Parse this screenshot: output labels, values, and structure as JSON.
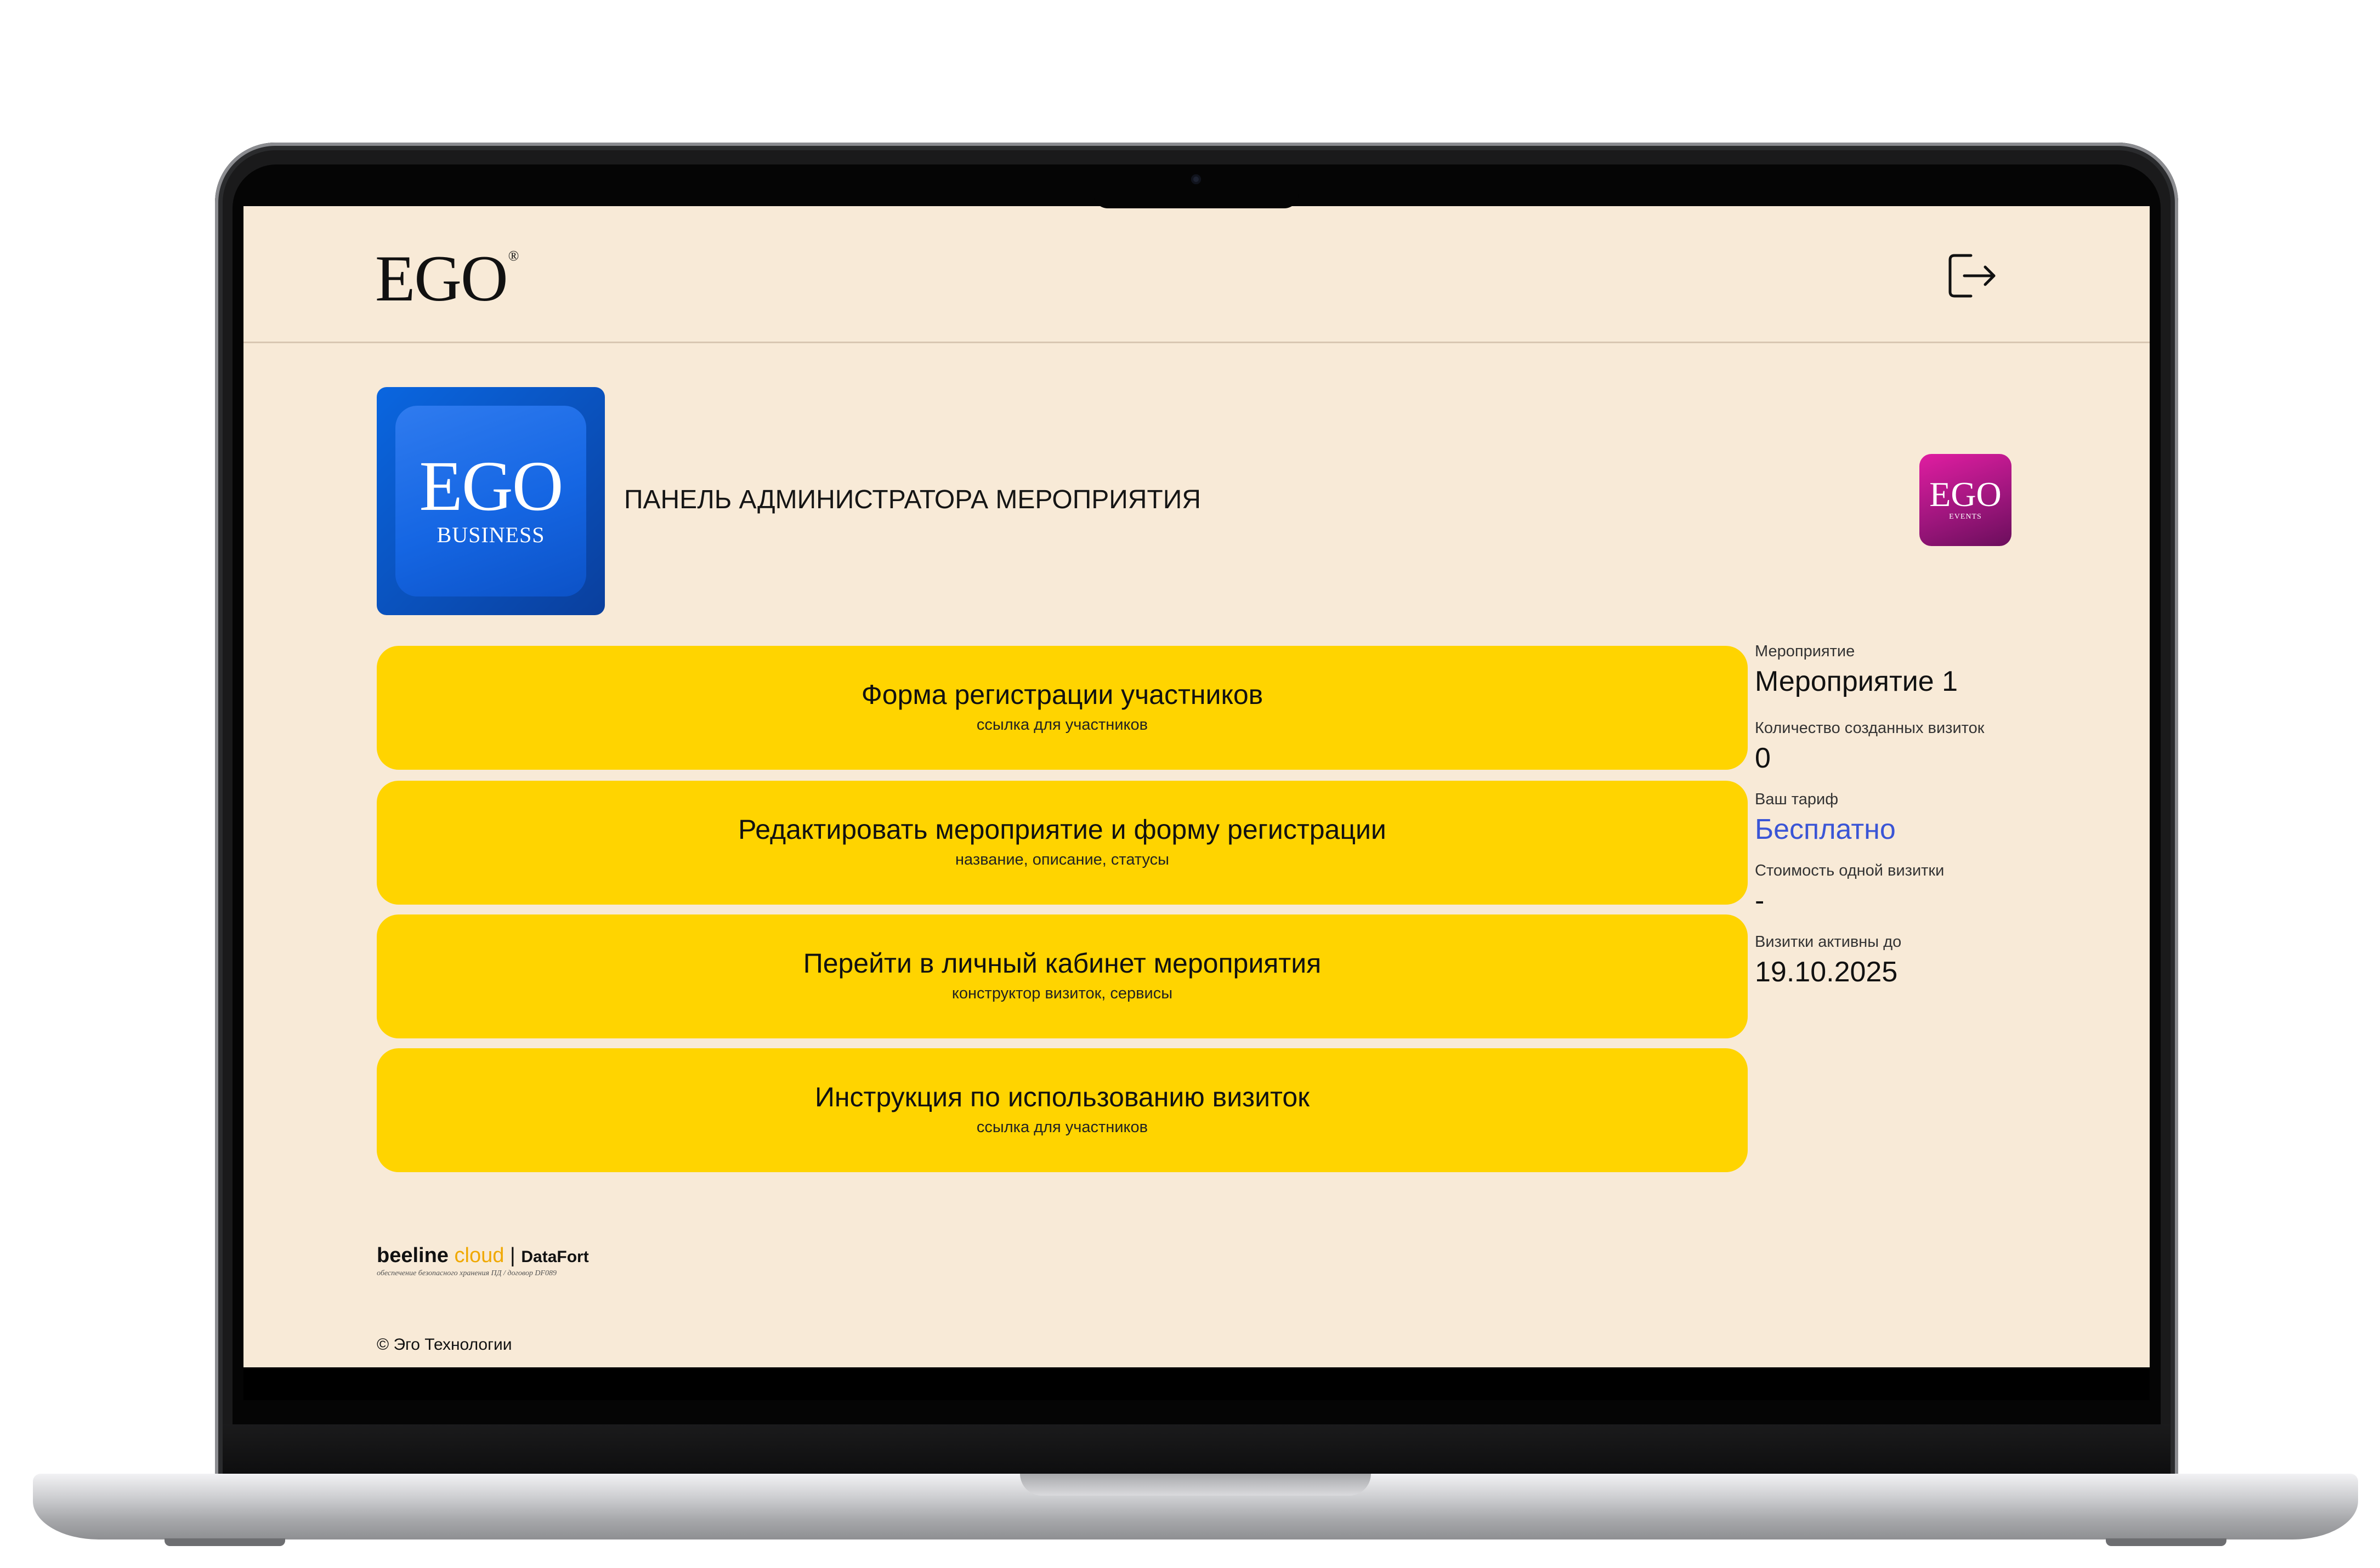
{
  "header": {
    "logo_text": "EGO",
    "logo_mark": "®",
    "logout_icon": "logout-icon"
  },
  "brand": {
    "business_logo": {
      "big": "EGO",
      "small": "BUSINESS"
    },
    "events_logo": {
      "big": "EGO",
      "small": "EVENTS"
    },
    "panel_title": "ПАНЕЛЬ АДМИНИСТРАТОРА МЕРОПРИЯТИЯ"
  },
  "menu": [
    {
      "title": "Форма регистрации участников",
      "subtitle": "ссылка для участников"
    },
    {
      "title": "Редактировать мероприятие и форму регистрации",
      "subtitle": "название, описание, статусы"
    },
    {
      "title": "Перейти в личный кабинет мероприятия",
      "subtitle": "конструктор визиток, сервисы"
    },
    {
      "title": "Инструкция по использованию визиток",
      "subtitle": "ссылка для участников"
    }
  ],
  "info": {
    "event_label": "Мероприятие",
    "event_value": "Мероприятие 1",
    "cards_label": "Количество созданных визиток",
    "cards_value": "0",
    "plan_label": "Ваш тариф",
    "plan_value": "Бесплатно",
    "price_label": "Стоимость одной визитки",
    "price_value": "-",
    "active_label": "Визитки активны до",
    "active_value": "19.10.2025"
  },
  "footer": {
    "partner_beeline": "beeline",
    "partner_cloud": "cloud",
    "partner_separator": "|",
    "partner_datafort": "DataFort",
    "partner_note": "обеспечение безопасного хранения ПД / договор DF089",
    "copyright": "© Эго Технологии"
  },
  "colors": {
    "background": "#f8ead7",
    "card_yellow": "#ffd400",
    "link_blue": "#3a55d6",
    "business_blue": "#0a66e0",
    "events_magenta": "#b0178a"
  }
}
